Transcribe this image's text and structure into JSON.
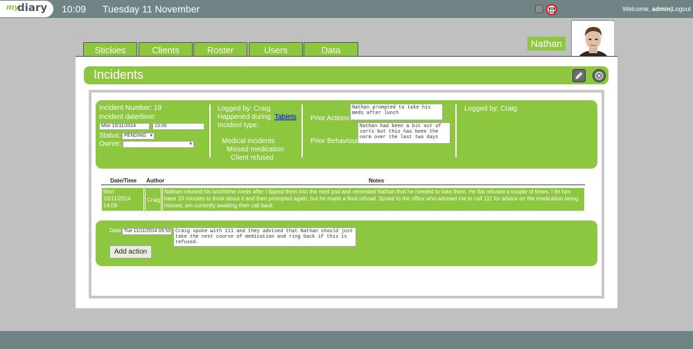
{
  "topbar": {
    "logo_my": "my",
    "logo_diary": "diary",
    "time": "10:09",
    "date": "Tuesday 11 November",
    "welcome_prefix": "Welcome, ",
    "username": "admin",
    "separator": "|",
    "logout": "Logout"
  },
  "tabs": [
    "Stickies",
    "Clients",
    "Roster",
    "Users",
    "Data"
  ],
  "client": {
    "name": "Nathan"
  },
  "page": {
    "title": "Incidents"
  },
  "incident": {
    "number_label": "Incident Number: 19",
    "datetime_label": "Incident date/time:",
    "date_value": "Mon 10/11/2014",
    "time_value": "13:00",
    "status_label": "Status:",
    "status_value": "PENDING",
    "owner_label": "Owner:",
    "owner_value": "",
    "logged_by": "Logged by: Craig",
    "happened_label": "Happened during:",
    "happened_value": "Tablets",
    "type_label": "Incident type:",
    "types": [
      "Medical incidents",
      "Missed medication",
      "Client refused"
    ],
    "prior_actions_label": "Prior Actions:",
    "prior_actions_value": "Nathan prompted to take his meds after lunch",
    "prior_behaviour_label": "Prior Behaviour:",
    "prior_behaviour_value": "Nathan had been a bit out of sorts but this has been the norm over the last two days",
    "logged_by_right": "Logged by: Craig"
  },
  "notes_table": {
    "headers": [
      "Date/Time",
      "Author",
      "Notes"
    ],
    "rows": [
      {
        "datetime": "Mon 10/11/2014 14:09",
        "author": "Craig",
        "notes": "Nathan refused his lunchtime meds after I tipped them into the med pod and reminded Nathan that he needed to take them. He flat refused a couple of times. I let him have 10 minutes to think about it and then prompted again, but he made a final refusal. Spoke to the office who advised me to call 111 for advice on the medication being missed, am currently awaiting their call back."
      }
    ]
  },
  "action": {
    "date_label": "Date",
    "date_value": "Tue 11/11/2014 09:59",
    "text_value": "Craig spoke with 111 and they advised that Nathan should just take the next course of medication and ring back if this is refused.",
    "add_button": "Add action"
  },
  "icons": {
    "edit": "pencil-icon",
    "close": "close-icon",
    "mail": "mail-icon",
    "notes": "notes-icon"
  },
  "colors": {
    "accent_green": "#8dc63f",
    "bar_gray": "#708486",
    "alert_red": "#ee1111"
  }
}
